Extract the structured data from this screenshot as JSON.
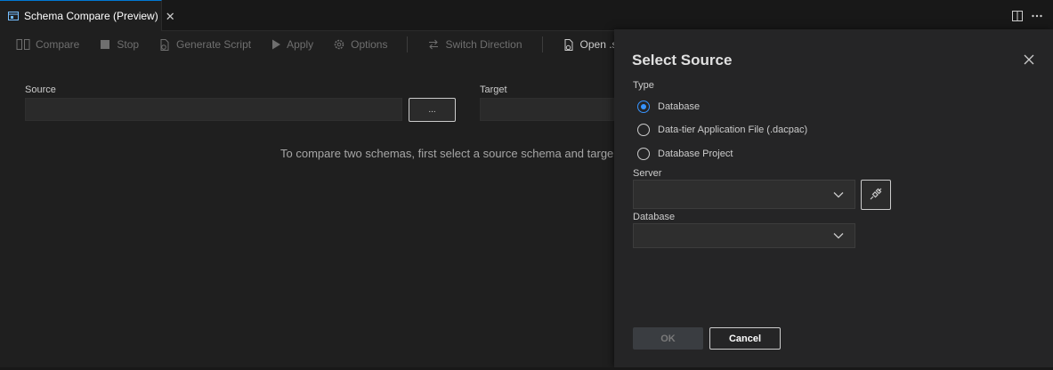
{
  "tab": {
    "title": "Schema Compare (Preview)",
    "icon": "schema-compare-icon",
    "close_glyph": "✕"
  },
  "tab_actions": {
    "split_icon": "split-editor-icon",
    "more_icon": "more-actions-icon"
  },
  "toolbar": {
    "compare": "Compare",
    "stop": "Stop",
    "generate_script": "Generate Script",
    "apply": "Apply",
    "options": "Options",
    "switch_direction": "Switch Direction",
    "open": "Open .s"
  },
  "form": {
    "source_label": "Source",
    "source_value": "",
    "browse_label": "...",
    "target_label": "Target",
    "target_value": "",
    "hint": "To compare two schemas, first select a source schema and targe"
  },
  "dialog": {
    "title": "Select Source",
    "type_label": "Type",
    "type_options": [
      {
        "label": "Database",
        "checked": true
      },
      {
        "label": "Data-tier Application File (.dacpac)",
        "checked": false
      },
      {
        "label": "Database Project",
        "checked": false
      }
    ],
    "server_label": "Server",
    "server_value": "",
    "database_label": "Database",
    "database_value": "",
    "ok_label": "OK",
    "cancel_label": "Cancel"
  },
  "colors": {
    "accent": "#0078d4",
    "radio_selected": "#3794ff",
    "background": "#1f1f1f",
    "dialog_background": "#252526"
  }
}
